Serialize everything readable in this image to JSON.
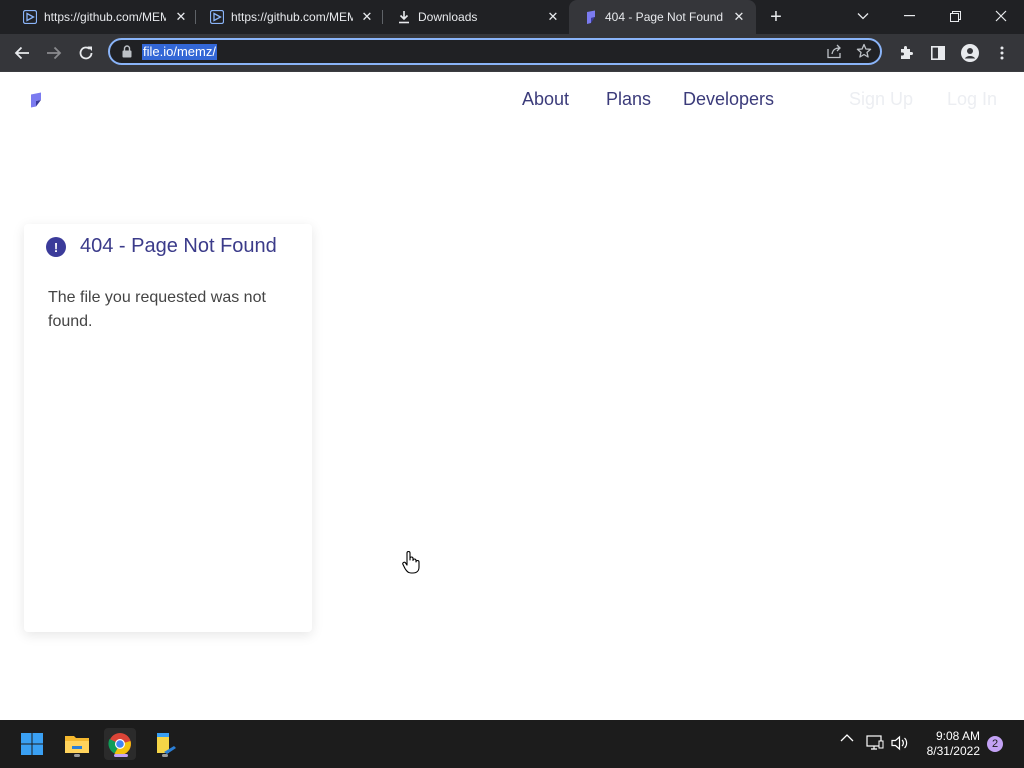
{
  "browser": {
    "tabs": [
      {
        "title": "https://github.com/MEMZ",
        "favicon": "vimeo-like-icon"
      },
      {
        "title": "https://github.com/MEMZ",
        "favicon": "vimeo-like-icon"
      },
      {
        "title": "Downloads",
        "favicon": "download-icon"
      },
      {
        "title": "404 - Page Not Found",
        "favicon": "file-io-logo-icon",
        "active": true
      }
    ],
    "address": "file.io/memz/",
    "accent_color": "#8ab4f8"
  },
  "site": {
    "nav": {
      "about": "About",
      "plans": "Plans",
      "developers": "Developers",
      "sign_up": "Sign Up",
      "log_in": "Log In"
    },
    "error": {
      "title": "404 - Page Not Found",
      "message": "The file you requested was not found."
    },
    "brand_color": "#3b3b8a"
  },
  "taskbar": {
    "apps": [
      "start-icon",
      "file-explorer-icon",
      "chrome-icon",
      "notepad-icon"
    ],
    "time": "9:08 AM",
    "date": "8/31/2022",
    "notification_count": "2"
  }
}
